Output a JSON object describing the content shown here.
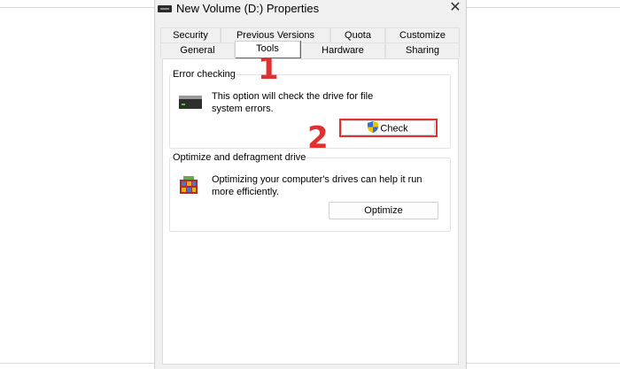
{
  "window": {
    "title": "New Volume (D:) Properties",
    "close_glyph": "✕"
  },
  "tabs_row1": [
    {
      "label": "Security"
    },
    {
      "label": "Previous Versions"
    },
    {
      "label": "Quota"
    },
    {
      "label": "Customize"
    }
  ],
  "tabs_row2": [
    {
      "label": "General"
    },
    {
      "label": "Tools",
      "active": true
    },
    {
      "label": "Hardware"
    },
    {
      "label": "Sharing"
    }
  ],
  "error_checking": {
    "title": "Error checking",
    "description_line1": "This option will check the drive for file",
    "description_line2": "system errors.",
    "button_label": "Check",
    "icon": "drive-icon"
  },
  "optimize": {
    "title": "Optimize and defragment drive",
    "description_line1": "Optimizing your computer's drives can help it run",
    "description_line2": "more efficiently.",
    "button_label": "Optimize",
    "icon": "defrag-icon"
  },
  "annotations": {
    "step1": "1",
    "step2": "2",
    "highlight_color": "#e03030"
  }
}
